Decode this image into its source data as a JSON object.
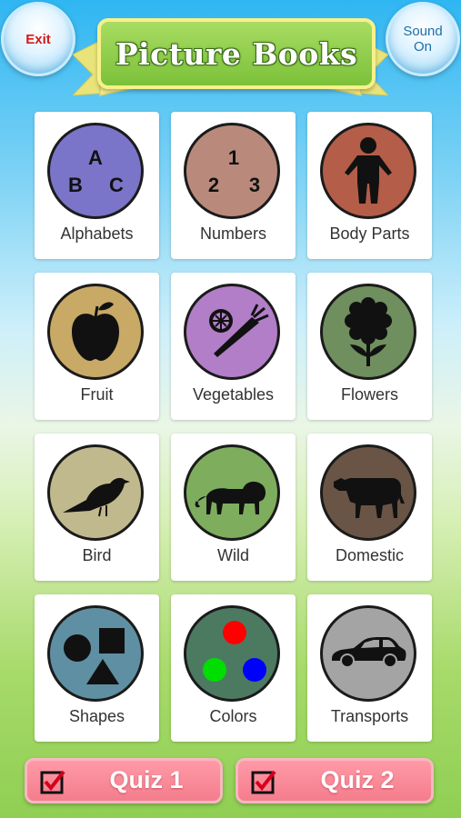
{
  "header": {
    "exit_label": "Exit",
    "sound_label": "Sound\nOn",
    "title": "Picture Books"
  },
  "categories": [
    {
      "label": "Alphabets",
      "icon": "letters-abc-icon",
      "color": "#7a75c8",
      "glyphs": [
        "A",
        "B",
        "C"
      ]
    },
    {
      "label": "Numbers",
      "icon": "numbers-123-icon",
      "color": "#b98a7c",
      "glyphs": [
        "1",
        "2",
        "3"
      ]
    },
    {
      "label": "Body Parts",
      "icon": "person-icon",
      "color": "#b45d48"
    },
    {
      "label": "Fruit",
      "icon": "apple-icon",
      "color": "#c8a965"
    },
    {
      "label": "Vegetables",
      "icon": "carrot-lemon-icon",
      "color": "#b27ec7"
    },
    {
      "label": "Flowers",
      "icon": "flower-icon",
      "color": "#6f8f5e"
    },
    {
      "label": "Bird",
      "icon": "bird-icon",
      "color": "#c1b98e"
    },
    {
      "label": "Wild",
      "icon": "lion-icon",
      "color": "#7dad5d"
    },
    {
      "label": "Domestic",
      "icon": "cow-icon",
      "color": "#695446"
    },
    {
      "label": "Shapes",
      "icon": "shapes-icon",
      "color": "#5f8fa2"
    },
    {
      "label": "Colors",
      "icon": "color-dots-icon",
      "color": "#4c7a61",
      "dots": [
        "#ff0000",
        "#00dd00",
        "#0000ff"
      ]
    },
    {
      "label": "Transports",
      "icon": "car-icon",
      "color": "#a4a4a4"
    }
  ],
  "quiz": [
    {
      "label": "Quiz 1"
    },
    {
      "label": "Quiz 2"
    }
  ]
}
